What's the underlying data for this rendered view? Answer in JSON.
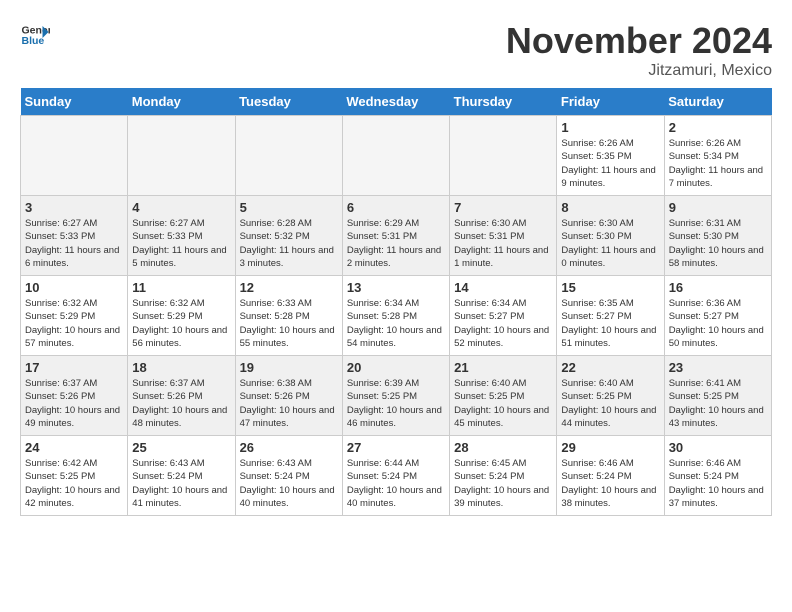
{
  "header": {
    "logo_general": "General",
    "logo_blue": "Blue",
    "month_title": "November 2024",
    "location": "Jitzamuri, Mexico"
  },
  "weekdays": [
    "Sunday",
    "Monday",
    "Tuesday",
    "Wednesday",
    "Thursday",
    "Friday",
    "Saturday"
  ],
  "weeks": [
    [
      {
        "day": "",
        "info": "",
        "empty": true
      },
      {
        "day": "",
        "info": "",
        "empty": true
      },
      {
        "day": "",
        "info": "",
        "empty": true
      },
      {
        "day": "",
        "info": "",
        "empty": true
      },
      {
        "day": "",
        "info": "",
        "empty": true
      },
      {
        "day": "1",
        "info": "Sunrise: 6:26 AM\nSunset: 5:35 PM\nDaylight: 11 hours and 9 minutes."
      },
      {
        "day": "2",
        "info": "Sunrise: 6:26 AM\nSunset: 5:34 PM\nDaylight: 11 hours and 7 minutes."
      }
    ],
    [
      {
        "day": "3",
        "info": "Sunrise: 6:27 AM\nSunset: 5:33 PM\nDaylight: 11 hours and 6 minutes."
      },
      {
        "day": "4",
        "info": "Sunrise: 6:27 AM\nSunset: 5:33 PM\nDaylight: 11 hours and 5 minutes."
      },
      {
        "day": "5",
        "info": "Sunrise: 6:28 AM\nSunset: 5:32 PM\nDaylight: 11 hours and 3 minutes."
      },
      {
        "day": "6",
        "info": "Sunrise: 6:29 AM\nSunset: 5:31 PM\nDaylight: 11 hours and 2 minutes."
      },
      {
        "day": "7",
        "info": "Sunrise: 6:30 AM\nSunset: 5:31 PM\nDaylight: 11 hours and 1 minute."
      },
      {
        "day": "8",
        "info": "Sunrise: 6:30 AM\nSunset: 5:30 PM\nDaylight: 11 hours and 0 minutes."
      },
      {
        "day": "9",
        "info": "Sunrise: 6:31 AM\nSunset: 5:30 PM\nDaylight: 10 hours and 58 minutes."
      }
    ],
    [
      {
        "day": "10",
        "info": "Sunrise: 6:32 AM\nSunset: 5:29 PM\nDaylight: 10 hours and 57 minutes."
      },
      {
        "day": "11",
        "info": "Sunrise: 6:32 AM\nSunset: 5:29 PM\nDaylight: 10 hours and 56 minutes."
      },
      {
        "day": "12",
        "info": "Sunrise: 6:33 AM\nSunset: 5:28 PM\nDaylight: 10 hours and 55 minutes."
      },
      {
        "day": "13",
        "info": "Sunrise: 6:34 AM\nSunset: 5:28 PM\nDaylight: 10 hours and 54 minutes."
      },
      {
        "day": "14",
        "info": "Sunrise: 6:34 AM\nSunset: 5:27 PM\nDaylight: 10 hours and 52 minutes."
      },
      {
        "day": "15",
        "info": "Sunrise: 6:35 AM\nSunset: 5:27 PM\nDaylight: 10 hours and 51 minutes."
      },
      {
        "day": "16",
        "info": "Sunrise: 6:36 AM\nSunset: 5:27 PM\nDaylight: 10 hours and 50 minutes."
      }
    ],
    [
      {
        "day": "17",
        "info": "Sunrise: 6:37 AM\nSunset: 5:26 PM\nDaylight: 10 hours and 49 minutes."
      },
      {
        "day": "18",
        "info": "Sunrise: 6:37 AM\nSunset: 5:26 PM\nDaylight: 10 hours and 48 minutes."
      },
      {
        "day": "19",
        "info": "Sunrise: 6:38 AM\nSunset: 5:26 PM\nDaylight: 10 hours and 47 minutes."
      },
      {
        "day": "20",
        "info": "Sunrise: 6:39 AM\nSunset: 5:25 PM\nDaylight: 10 hours and 46 minutes."
      },
      {
        "day": "21",
        "info": "Sunrise: 6:40 AM\nSunset: 5:25 PM\nDaylight: 10 hours and 45 minutes."
      },
      {
        "day": "22",
        "info": "Sunrise: 6:40 AM\nSunset: 5:25 PM\nDaylight: 10 hours and 44 minutes."
      },
      {
        "day": "23",
        "info": "Sunrise: 6:41 AM\nSunset: 5:25 PM\nDaylight: 10 hours and 43 minutes."
      }
    ],
    [
      {
        "day": "24",
        "info": "Sunrise: 6:42 AM\nSunset: 5:25 PM\nDaylight: 10 hours and 42 minutes."
      },
      {
        "day": "25",
        "info": "Sunrise: 6:43 AM\nSunset: 5:24 PM\nDaylight: 10 hours and 41 minutes."
      },
      {
        "day": "26",
        "info": "Sunrise: 6:43 AM\nSunset: 5:24 PM\nDaylight: 10 hours and 40 minutes."
      },
      {
        "day": "27",
        "info": "Sunrise: 6:44 AM\nSunset: 5:24 PM\nDaylight: 10 hours and 40 minutes."
      },
      {
        "day": "28",
        "info": "Sunrise: 6:45 AM\nSunset: 5:24 PM\nDaylight: 10 hours and 39 minutes."
      },
      {
        "day": "29",
        "info": "Sunrise: 6:46 AM\nSunset: 5:24 PM\nDaylight: 10 hours and 38 minutes."
      },
      {
        "day": "30",
        "info": "Sunrise: 6:46 AM\nSunset: 5:24 PM\nDaylight: 10 hours and 37 minutes."
      }
    ]
  ]
}
